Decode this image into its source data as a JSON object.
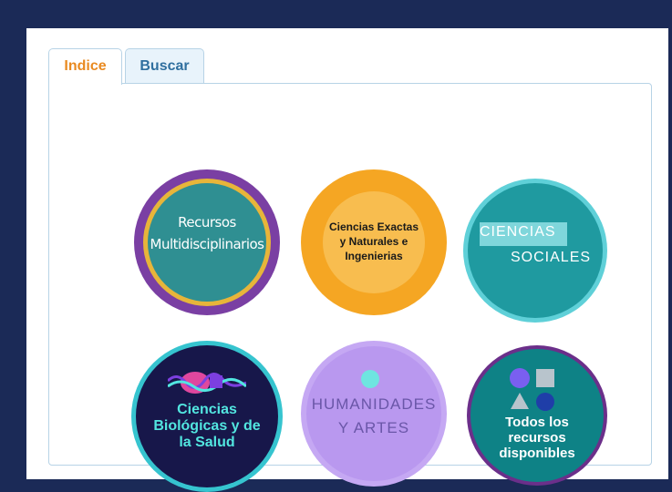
{
  "tabs": [
    {
      "label": "Indice",
      "active": true
    },
    {
      "label": "Buscar",
      "active": false
    }
  ],
  "categories": [
    {
      "lines": [
        "Recursos",
        "Multidisciplinarios"
      ]
    },
    {
      "lines": [
        "Ciencias Exactas",
        "y Naturales e",
        "Ingenierias"
      ]
    },
    {
      "lines": [
        "CIENCIAS",
        "SOCIALES"
      ]
    },
    {
      "lines": [
        "Ciencias",
        "Biológicas y de",
        "la Salud"
      ]
    },
    {
      "lines": [
        "HUMANIDADES",
        "Y ARTES"
      ]
    },
    {
      "lines": [
        "Todos los",
        "recursos",
        "disponibles"
      ]
    }
  ],
  "colors": {
    "accent_tab": "#e98a21",
    "inactive_tab": "#2f6f9f",
    "frame_bg": "#1b2a57"
  }
}
